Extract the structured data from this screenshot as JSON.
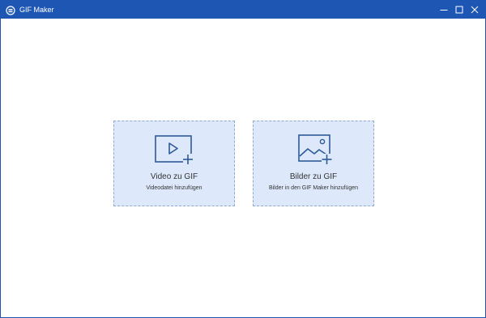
{
  "window": {
    "title": "GIF Maker",
    "app_icon": "gif-maker-logo-icon",
    "controls": [
      "minimize-icon",
      "maximize-icon",
      "close-icon"
    ]
  },
  "colors": {
    "titlebar": "#1e57b3",
    "card_background": "#dde9fb",
    "card_border": "#8fa9cf",
    "icon_stroke": "#2e5a97"
  },
  "cards": {
    "video": {
      "title": "Video zu GIF",
      "subtitle": "Videodatei hinzufügen",
      "icon": "video-add-icon"
    },
    "images": {
      "title": "Bilder zu GIF",
      "subtitle": "Bilder in den GIF Maker hinzufügen",
      "icon": "image-add-icon"
    }
  }
}
